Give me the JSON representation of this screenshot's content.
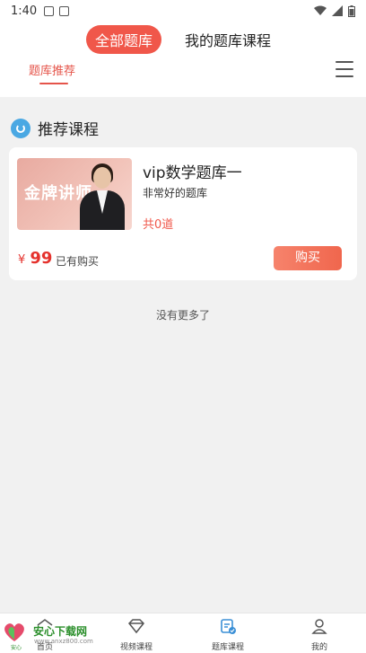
{
  "status_bar": {
    "time": "1:40"
  },
  "header": {
    "segments": [
      {
        "label": "全部题库",
        "active": true
      },
      {
        "label": "我的题库课程",
        "active": false
      }
    ],
    "subtab": "题库推荐"
  },
  "section": {
    "title": "推荐课程"
  },
  "course": {
    "thumb_text": "金牌讲师",
    "title": "vip数学题库一",
    "desc": "非常好的题库",
    "count": "共0道",
    "price_symbol": "¥",
    "price": "99",
    "bought": "已有购买",
    "buy_label": "购买"
  },
  "list_footer": "没有更多了",
  "bottom_nav": [
    {
      "label": "首页",
      "icon": "home-icon"
    },
    {
      "label": "视频课程",
      "icon": "diamond-icon"
    },
    {
      "label": "题库课程",
      "icon": "question-bank-icon"
    },
    {
      "label": "我的",
      "icon": "user-icon"
    }
  ],
  "watermark": {
    "title": "安心下载网",
    "url": "www.anxz800.com",
    "small": "安心"
  },
  "colors": {
    "accent": "#f0574a",
    "section_icon": "#4aa8e3",
    "price": "#e5322d",
    "watermark": "#2b8f2b"
  }
}
